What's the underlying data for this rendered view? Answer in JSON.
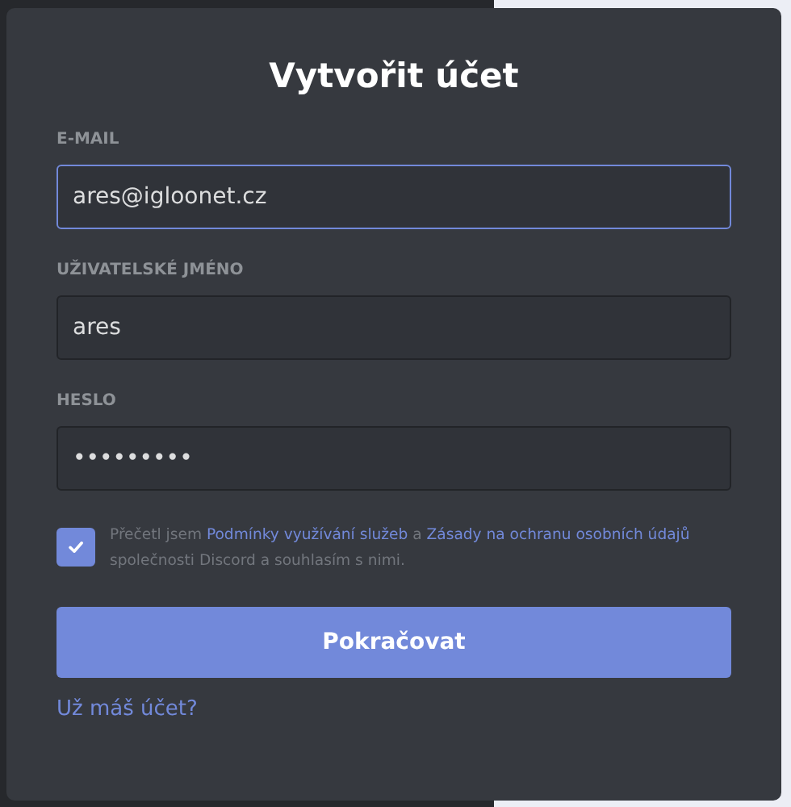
{
  "title": "Vytvořit účet",
  "fields": [
    {
      "label": "E-MAIL",
      "value": "ares@igloonet.cz",
      "focused": true
    },
    {
      "label": "UŽIVATELSKÉ JMÉNO",
      "value": "ares",
      "focused": false
    },
    {
      "label": "HESLO",
      "value": "•••••••••",
      "focused": false
    }
  ],
  "agreement": {
    "checked": true,
    "segments": [
      {
        "kind": "text",
        "text": "Přečetl jsem "
      },
      {
        "kind": "link",
        "text": "Podmínky využívání služeb"
      },
      {
        "kind": "text",
        "text": " a "
      },
      {
        "kind": "link",
        "text": "Zásady na ochranu osobních údajů"
      },
      {
        "kind": "text",
        "text": " společnosti Discord a souhlasím s nimi."
      }
    ]
  },
  "submit": "Pokračovat",
  "login_link": "Už máš účet?"
}
